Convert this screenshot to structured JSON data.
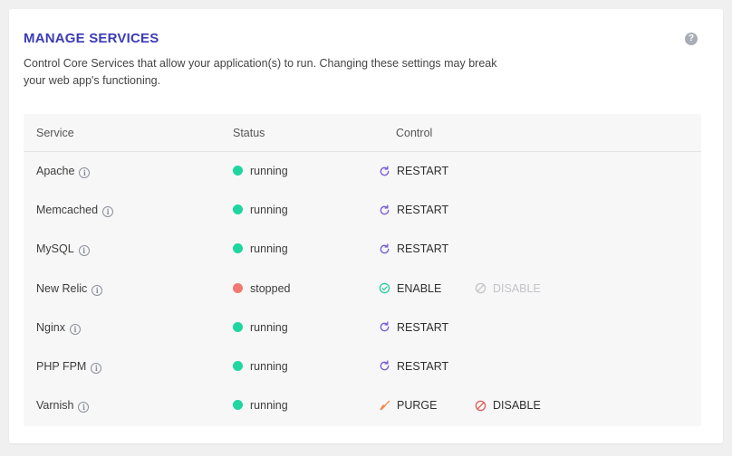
{
  "header": {
    "title": "MANAGE SERVICES",
    "help_glyph": "?",
    "description": "Control Core Services that allow your application(s) to run. Changing these settings may break your web app's functioning."
  },
  "table": {
    "columns": [
      "Service",
      "Status",
      "Control"
    ],
    "rows": [
      {
        "service": "Apache",
        "status": "running",
        "control1": "RESTART",
        "control1_icon": "restart-icon"
      },
      {
        "service": "Memcached",
        "status": "running",
        "control1": "RESTART",
        "control1_icon": "restart-icon"
      },
      {
        "service": "MySQL",
        "status": "running",
        "control1": "RESTART",
        "control1_icon": "restart-icon"
      },
      {
        "service": "New Relic",
        "status": "stopped",
        "control1": "ENABLE",
        "control1_icon": "check-circle-icon",
        "control2": "DISABLE",
        "control2_icon": "disable-icon",
        "control2_disabled": true
      },
      {
        "service": "Nginx",
        "status": "running",
        "control1": "RESTART",
        "control1_icon": "restart-icon"
      },
      {
        "service": "PHP FPM",
        "status": "running",
        "control1": "RESTART",
        "control1_icon": "restart-icon"
      },
      {
        "service": "Varnish",
        "status": "running",
        "control1": "PURGE",
        "control1_icon": "broom-icon",
        "control2": "DISABLE",
        "control2_icon": "disable-icon",
        "control2_disabled": false
      }
    ]
  },
  "colors": {
    "title": "#3b3bb8",
    "running": "#1fd6a0",
    "stopped": "#f07a72",
    "restart_icon": "#7b5fd6",
    "enable_icon": "#20c997",
    "purge_icon": "#f08a4b",
    "disable_active": "#e05a5a",
    "disable_inactive": "#c4c4c8"
  }
}
